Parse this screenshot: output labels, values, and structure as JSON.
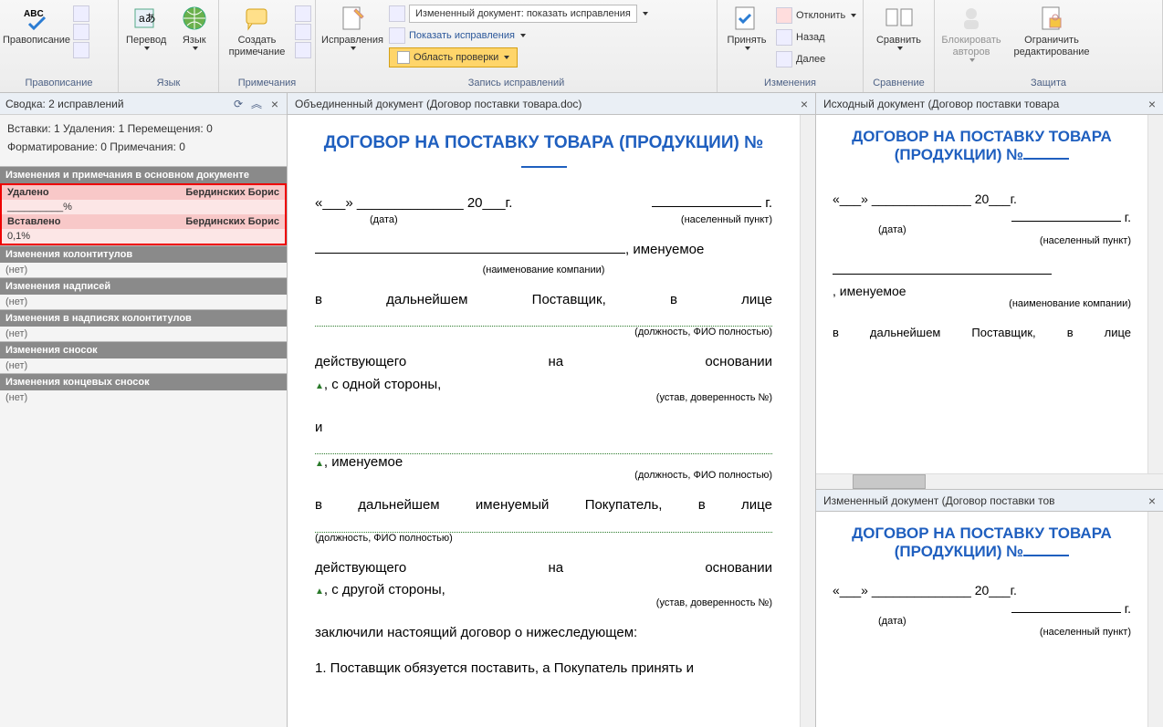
{
  "ribbon": {
    "spelling": "Правописание",
    "translate": "Перевод",
    "language": "Язык",
    "group_spelling": "Правописание",
    "group_language": "Язык",
    "new_comment": "Создать примечание",
    "group_comments": "Примечания",
    "track": "Исправления",
    "display_label": "Измененный документ: показать исправления",
    "show_markup": "Показать исправления",
    "review_pane": "Область проверки",
    "group_tracking": "Запись исправлений",
    "accept": "Принять",
    "reject": "Отклонить",
    "prev": "Назад",
    "next": "Далее",
    "group_changes": "Изменения",
    "compare": "Сравнить",
    "group_compare": "Сравнение",
    "block_authors": "Блокировать авторов",
    "restrict": "Ограничить редактирование",
    "group_protect": "Защита"
  },
  "summary": {
    "title": "Сводка: 2 исправлений",
    "stats1": "Вставки: 1 Удаления: 1 Перемещения: 0",
    "stats2": "Форматирование: 0 Примечания: 0",
    "hdr_main": "Изменения и примечания в основном документе",
    "del_label": "Удалено",
    "del_author": "Бердинских Борис",
    "del_detail": "__________%",
    "ins_label": "Вставлено",
    "ins_author": "Бердинских Борис",
    "ins_detail": "0,1%",
    "hdr_headers": "Изменения колонтитулов",
    "none": "(нет)",
    "hdr_captions": "Изменения надписей",
    "hdr_header_captions": "Изменения в надписях колонтитулов",
    "hdr_footnotes": "Изменения сносок",
    "hdr_endnotes": "Изменения концевых сносок"
  },
  "center": {
    "title": "Объединенный документ (Договор поставки товара.doc)"
  },
  "right_top": {
    "title": "Исходный документ (Договор поставки товара"
  },
  "right_bottom": {
    "title": "Измененный документ (Договор поставки тов"
  },
  "doc": {
    "heading_pre": "ДОГОВОР НА ПОСТАВКУ ТОВАРА (ПРОДУКЦИИ) №",
    "date_left": "«___»  ______________  20___г.",
    "date_right_g": "г.",
    "date_note": "(дата)",
    "city_note": "(населенный пункт)",
    "p_named": ", именуемое",
    "comp_note": "(наименование компании)",
    "p_supplier": "в дальнейшем Поставщик, в лице",
    "fio_note": "(должность, ФИО полностью)",
    "p_acting": "действующего на основании",
    "p_side1": ", с одной стороны,",
    "ustav_note": "(устав, доверенность №)",
    "p_and": "и",
    "p_named2": ", именуемое",
    "p_buyer": "в дальнейшем именуемый Покупатель, в лице",
    "p_side2": ", с другой стороны,",
    "p_concluded": "заключили настоящий договор о нижеследующем:",
    "p_clause1": "1. Поставщик обязуется поставить, а Покупатель принять и"
  }
}
